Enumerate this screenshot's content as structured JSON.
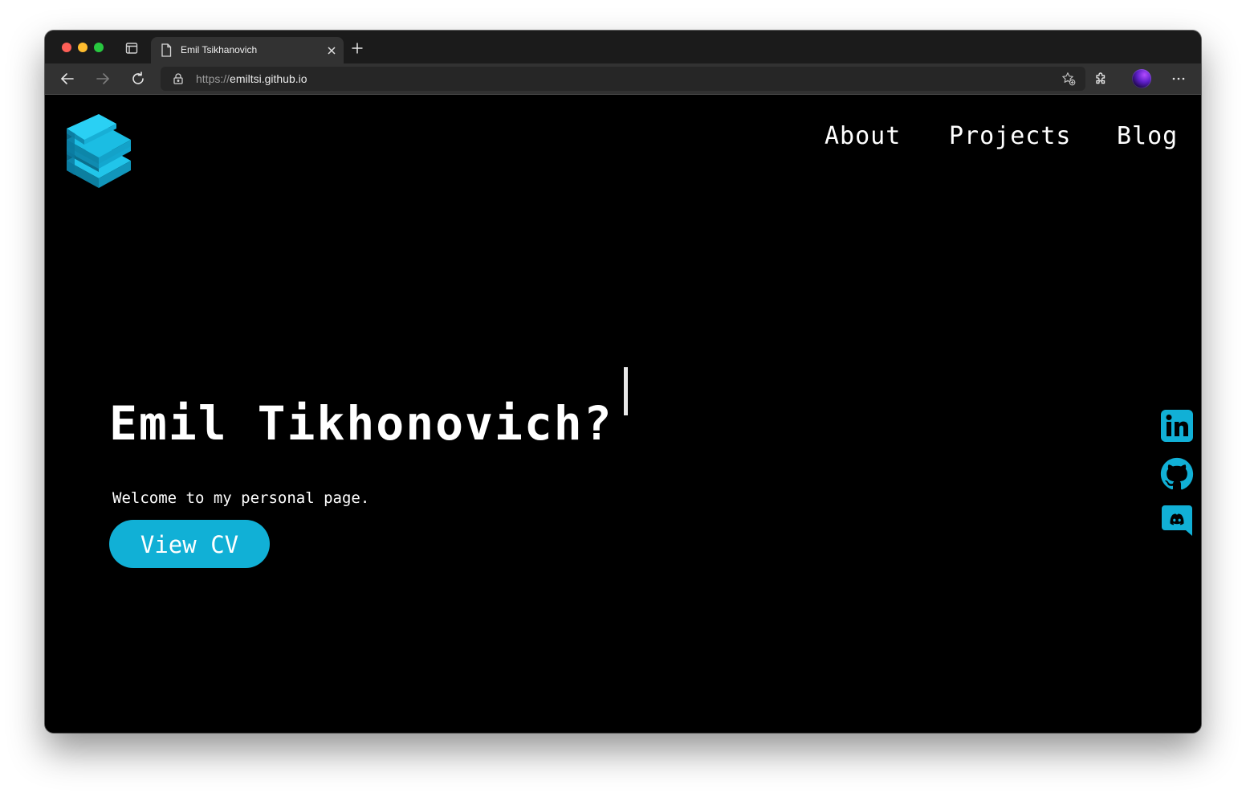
{
  "browser": {
    "tab": {
      "title": "Emil Tsikhanovich"
    },
    "address": {
      "scheme": "https://",
      "host": "emiltsi.github.io"
    }
  },
  "page": {
    "nav": {
      "about": "About",
      "projects": "Projects",
      "blog": "Blog"
    },
    "hero": {
      "title": "Emil Tikhonovich?",
      "subtitle": "Welcome to my personal page.",
      "cv_button": "View CV"
    },
    "social": [
      "linkedin-icon",
      "github-icon",
      "discord-icon"
    ]
  },
  "colors": {
    "accent": "#11b0d6",
    "page_background": "#000000",
    "text": "#ffffff",
    "tabstrip": "#1b1b1b",
    "toolbar": "#323232"
  }
}
